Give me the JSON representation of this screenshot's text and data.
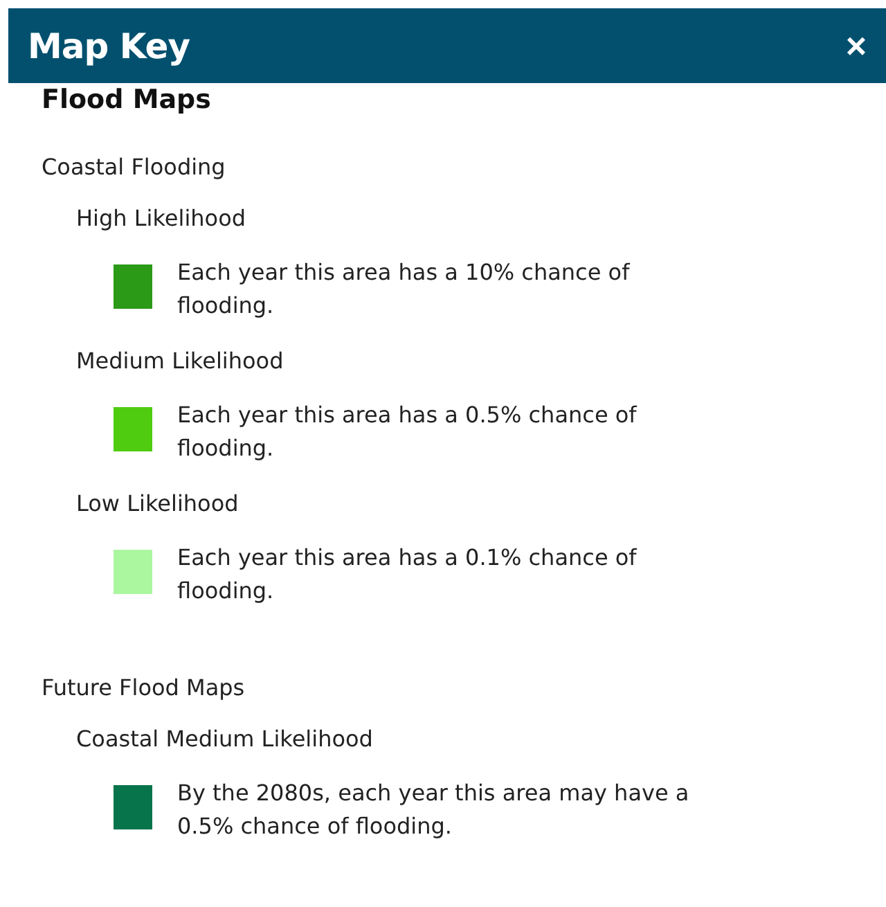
{
  "window": {
    "title": "Map Key",
    "close": "×"
  },
  "heading": "Flood Maps",
  "sections": [
    {
      "title": "Coastal Flooding",
      "groups": [
        {
          "label": "High Likelihood",
          "items": [
            {
              "color": "#2a9a17",
              "description": "Each year this area has a 10% chance of flooding."
            }
          ]
        },
        {
          "label": "Medium Likelihood",
          "items": [
            {
              "color": "#4fcc10",
              "description": "Each year this area has a 0.5% chance of flooding."
            }
          ]
        },
        {
          "label": "Low Likelihood",
          "items": [
            {
              "color": "#aaf7a0",
              "description": "Each year this area has a 0.1% chance of flooding."
            }
          ]
        }
      ]
    },
    {
      "title": "Future Flood Maps",
      "groups": [
        {
          "label": "Coastal Medium Likelihood",
          "items": [
            {
              "color": "#08744c",
              "description": "By the 2080s, each year this area may have a 0.5% chance of flooding."
            }
          ]
        }
      ]
    }
  ]
}
